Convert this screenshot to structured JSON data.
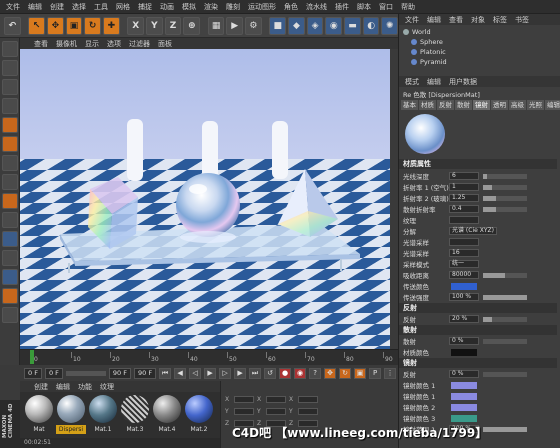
{
  "menubar": [
    "文件",
    "编辑",
    "创建",
    "选择",
    "工具",
    "网格",
    "捕捉",
    "动画",
    "模拟",
    "渲染",
    "雕刻",
    "运动图形",
    "角色",
    "流水线",
    "插件",
    "脚本",
    "窗口",
    "帮助"
  ],
  "viewport_menu": [
    "查看",
    "摄像机",
    "显示",
    "选项",
    "过滤器",
    "面板"
  ],
  "objects_panel": {
    "menu": [
      "文件",
      "编辑",
      "查看",
      "对象",
      "标签",
      "书签"
    ],
    "items": [
      "World",
      "Sphere",
      "Platonic",
      "Pyramid"
    ]
  },
  "attr_panel": {
    "menu": [
      "模式",
      "编辑",
      "用户数据"
    ],
    "title": "Re 色散 [DispersionMat]",
    "tabs": [
      "基本",
      "材质",
      "反射",
      "散射",
      "镜射",
      "透明",
      "高级",
      "光照",
      "编辑"
    ],
    "active_tab": "镜射"
  },
  "props": {
    "section_material": "材质属性",
    "rows": [
      {
        "k": "光线深度",
        "v": "6"
      },
      {
        "k": "折射率 1 (空气)",
        "v": "1"
      },
      {
        "k": "折射率 2 (玻璃)",
        "v": "1.25"
      },
      {
        "k": "散射折射率",
        "v": "0.4"
      },
      {
        "k": "纹理",
        "v": ""
      },
      {
        "k": "分解",
        "v": "光谱 (Cie XYZ)"
      },
      {
        "k": "光谱采样",
        "v": ""
      },
      {
        "k": "光谱采样",
        "v": "16"
      },
      {
        "k": "采样模式",
        "v": "统一"
      },
      {
        "k": "吸收距离",
        "v": "80000"
      },
      {
        "k": "传送颜色",
        "v": ""
      },
      {
        "k": "传送强度",
        "v": "100 %"
      }
    ],
    "section_reflect": "反射",
    "reflect_row": {
      "k": "反射",
      "v": "20 %"
    },
    "section_scatter": "散射",
    "scatter_rows": [
      {
        "k": "散射",
        "v": "0 %"
      },
      {
        "k": "材质颜色",
        "v": ""
      }
    ],
    "section_mirror": "镜射",
    "mirror_rows": [
      {
        "k": "反射",
        "v": "0 %"
      },
      {
        "k": "镜射颜色 1",
        "v": ""
      },
      {
        "k": "镜射颜色 1",
        "v": ""
      },
      {
        "k": "镜射颜色 2",
        "v": ""
      },
      {
        "k": "镜射颜色 3",
        "v": ""
      },
      {
        "k": "镜射范围 1",
        "v": "200 %"
      }
    ]
  },
  "timeline": {
    "labels": [
      "0",
      "10",
      "20",
      "30",
      "40",
      "50",
      "60",
      "70",
      "80",
      "90"
    ],
    "start": "0 F",
    "field2": "0 F",
    "end": "90 F",
    "field4": "90 F",
    "frame": "0 F"
  },
  "mat_menu": [
    "创建",
    "编辑",
    "功能",
    "纹理"
  ],
  "materials": [
    "Mat",
    "Dispersi",
    "Mat.1",
    "Mat.3",
    "Mat.4",
    "Mat.2"
  ],
  "coords_labels": [
    "X",
    "Y",
    "Z"
  ],
  "status": "00:02:51",
  "logo": "MAXON CINEMA 4D",
  "watermark": "C4D吧 【www.lineeg.com/tieba/1799】",
  "colors": {
    "accent": "#d87a1e",
    "blue": "#3b5c8a",
    "swatch_blue": "#3060d0",
    "swatch_mirror": "#8a8ae0"
  }
}
